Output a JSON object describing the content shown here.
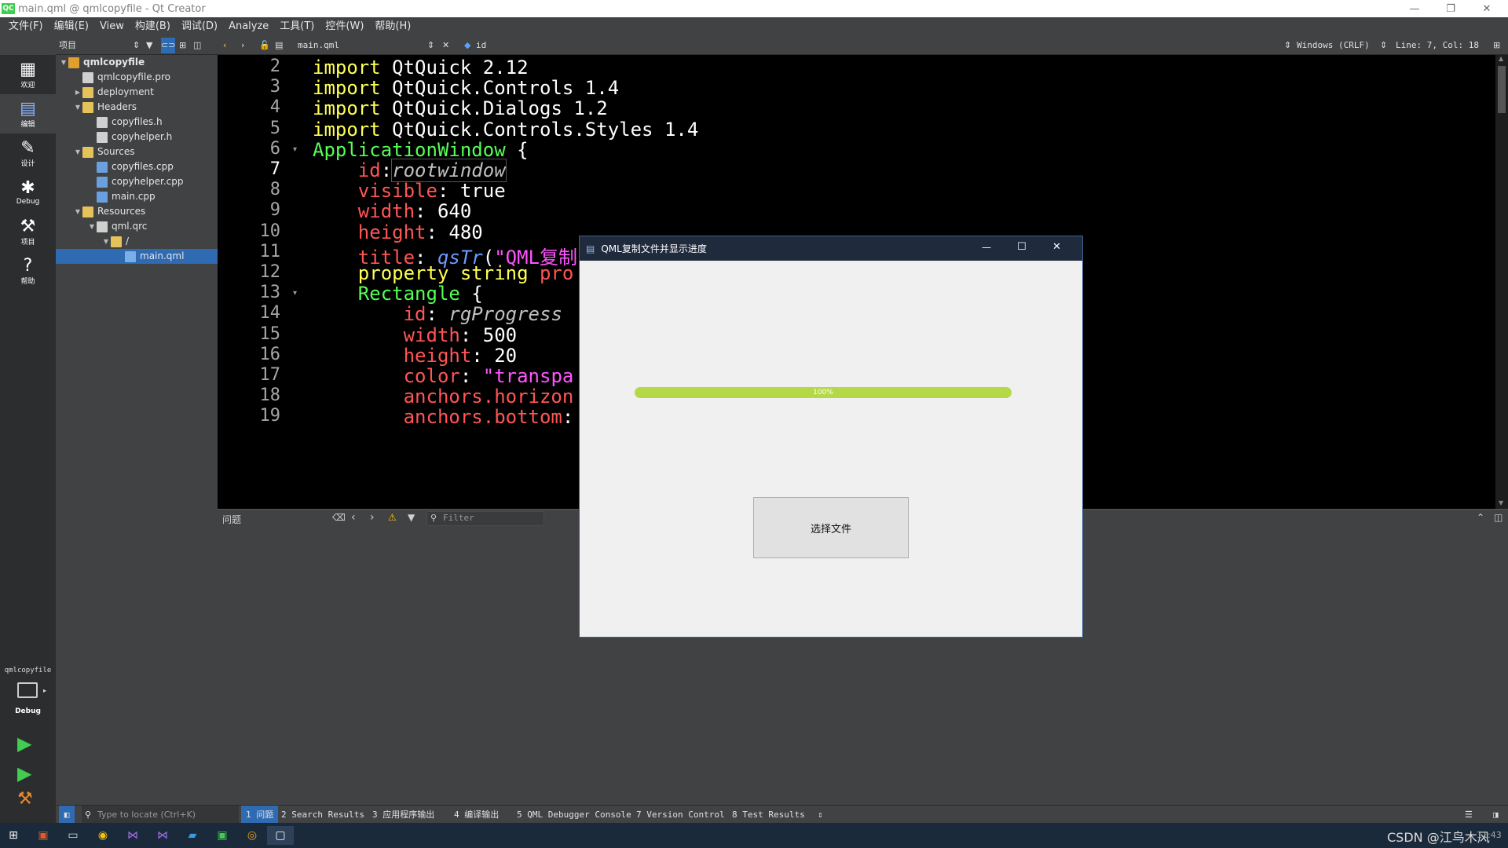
{
  "window": {
    "title": "main.qml @ qmlcopyfile - Qt Creator",
    "logo": "QC"
  },
  "menu": [
    "文件(F)",
    "编辑(E)",
    "View",
    "构建(B)",
    "调试(D)",
    "Analyze",
    "工具(T)",
    "控件(W)",
    "帮助(H)"
  ],
  "navbar": {
    "project_selector": "项目",
    "open_file": "main.qml",
    "symbol": "id",
    "line_ending": "Windows (CRLF)",
    "cursor_pos": "Line: 7, Col: 18"
  },
  "modes": [
    {
      "label": "欢迎",
      "icon": "grid-icon"
    },
    {
      "label": "编辑",
      "icon": "edit-icon"
    },
    {
      "label": "设计",
      "icon": "design-icon"
    },
    {
      "label": "Debug",
      "icon": "bug-icon"
    },
    {
      "label": "项目",
      "icon": "wrench-icon"
    },
    {
      "label": "帮助",
      "icon": "help-icon"
    }
  ],
  "tree": [
    {
      "label": "qmlcopyfile",
      "depth": 0,
      "expanded": true,
      "bold": true,
      "kind": "project"
    },
    {
      "label": "qmlcopyfile.pro",
      "depth": 1,
      "kind": "file"
    },
    {
      "label": "deployment",
      "depth": 1,
      "expanded": false,
      "kind": "folder"
    },
    {
      "label": "Headers",
      "depth": 1,
      "expanded": true,
      "kind": "folder"
    },
    {
      "label": "copyfiles.h",
      "depth": 2,
      "kind": "file"
    },
    {
      "label": "copyhelper.h",
      "depth": 2,
      "kind": "file"
    },
    {
      "label": "Sources",
      "depth": 1,
      "expanded": true,
      "kind": "folder"
    },
    {
      "label": "copyfiles.cpp",
      "depth": 2,
      "kind": "cpp"
    },
    {
      "label": "copyhelper.cpp",
      "depth": 2,
      "kind": "cpp"
    },
    {
      "label": "main.cpp",
      "depth": 2,
      "kind": "cpp"
    },
    {
      "label": "Resources",
      "depth": 1,
      "expanded": true,
      "kind": "folder"
    },
    {
      "label": "qml.qrc",
      "depth": 2,
      "expanded": true,
      "kind": "qrc"
    },
    {
      "label": "/",
      "depth": 3,
      "expanded": true,
      "kind": "folder"
    },
    {
      "label": "main.qml",
      "depth": 4,
      "kind": "qml",
      "selected": true
    }
  ],
  "code": {
    "current_line": 7,
    "folds": [
      6,
      13
    ],
    "lines": [
      {
        "n": "2",
        "tokens": [
          [
            "kw",
            "import "
          ],
          [
            "",
            "QtQuick 2.12"
          ]
        ]
      },
      {
        "n": "3",
        "tokens": [
          [
            "kw",
            "import "
          ],
          [
            "",
            "QtQuick.Controls 1.4"
          ]
        ]
      },
      {
        "n": "4",
        "tokens": [
          [
            "kw",
            "import "
          ],
          [
            "",
            "QtQuick.Dialogs 1.2"
          ]
        ]
      },
      {
        "n": "5",
        "tokens": [
          [
            "kw",
            "import "
          ],
          [
            "",
            "QtQuick.Controls.Styles 1.4"
          ]
        ]
      },
      {
        "n": "6",
        "tokens": [
          [
            "ty",
            "ApplicationWindow"
          ],
          [
            "",
            " {"
          ]
        ]
      },
      {
        "n": "7",
        "tokens": [
          [
            "",
            "    "
          ],
          [
            "pr",
            "id"
          ],
          [
            "",
            ":"
          ],
          [
            "it",
            "rootwindow"
          ]
        ]
      },
      {
        "n": "8",
        "tokens": [
          [
            "",
            "    "
          ],
          [
            "pr",
            "visible"
          ],
          [
            "",
            ": "
          ],
          [
            "",
            "true"
          ]
        ]
      },
      {
        "n": "9",
        "tokens": [
          [
            "",
            "    "
          ],
          [
            "pr",
            "width"
          ],
          [
            "",
            ": 640"
          ]
        ]
      },
      {
        "n": "10",
        "tokens": [
          [
            "",
            "    "
          ],
          [
            "pr",
            "height"
          ],
          [
            "",
            ": 480"
          ]
        ]
      },
      {
        "n": "11",
        "tokens": [
          [
            "",
            "    "
          ],
          [
            "pr",
            "title"
          ],
          [
            "",
            ": "
          ],
          [
            "fn",
            "qsTr"
          ],
          [
            "",
            "("
          ],
          [
            "st",
            "\"QML复制"
          ]
        ]
      },
      {
        "n": "12",
        "tokens": [
          [
            "",
            "    "
          ],
          [
            "kw",
            "property string "
          ],
          [
            "pr",
            "pro"
          ]
        ]
      },
      {
        "n": "13",
        "tokens": [
          [
            "",
            "    "
          ],
          [
            "ty",
            "Rectangle"
          ],
          [
            "",
            " {"
          ]
        ]
      },
      {
        "n": "14",
        "tokens": [
          [
            "",
            "        "
          ],
          [
            "pr",
            "id"
          ],
          [
            "",
            ": "
          ],
          [
            "it",
            "rgProgress"
          ]
        ]
      },
      {
        "n": "15",
        "tokens": [
          [
            "",
            "        "
          ],
          [
            "pr",
            "width"
          ],
          [
            "",
            ": 500"
          ]
        ]
      },
      {
        "n": "16",
        "tokens": [
          [
            "",
            "        "
          ],
          [
            "pr",
            "height"
          ],
          [
            "",
            ": 20"
          ]
        ]
      },
      {
        "n": "17",
        "tokens": [
          [
            "",
            "        "
          ],
          [
            "pr",
            "color"
          ],
          [
            "",
            ": "
          ],
          [
            "st",
            "\"transpa"
          ]
        ]
      },
      {
        "n": "18",
        "tokens": [
          [
            "",
            "        "
          ],
          [
            "pr",
            "anchors.horizon"
          ]
        ]
      },
      {
        "n": "19",
        "tokens": [
          [
            "",
            "        "
          ],
          [
            "pr",
            "anchors.bottom"
          ],
          [
            "",
            ":"
          ]
        ]
      }
    ]
  },
  "issues": {
    "title": "问题",
    "filter_placeholder": "Filter"
  },
  "kit": {
    "project": "qmlcopyfile",
    "mode": "Debug"
  },
  "statusbar": {
    "locate_placeholder": "Type to locate (Ctrl+K)",
    "tabs": [
      "1 问题",
      "2 Search Results",
      "3 应用程序输出",
      "4 编译输出",
      "5 QML Debugger Console",
      "7 Version Control",
      "8 Test Results"
    ]
  },
  "app": {
    "title": "QML复制文件并显示进度",
    "progress_percent": 100,
    "progress_label": "100%",
    "button_label": "选择文件"
  },
  "taskbar": {
    "watermark": "CSDN @江鸟木风",
    "clock": "11:43"
  },
  "colors": {
    "accent": "#2f6bb3",
    "progress": "#b5d847",
    "run": "#41cd52"
  }
}
